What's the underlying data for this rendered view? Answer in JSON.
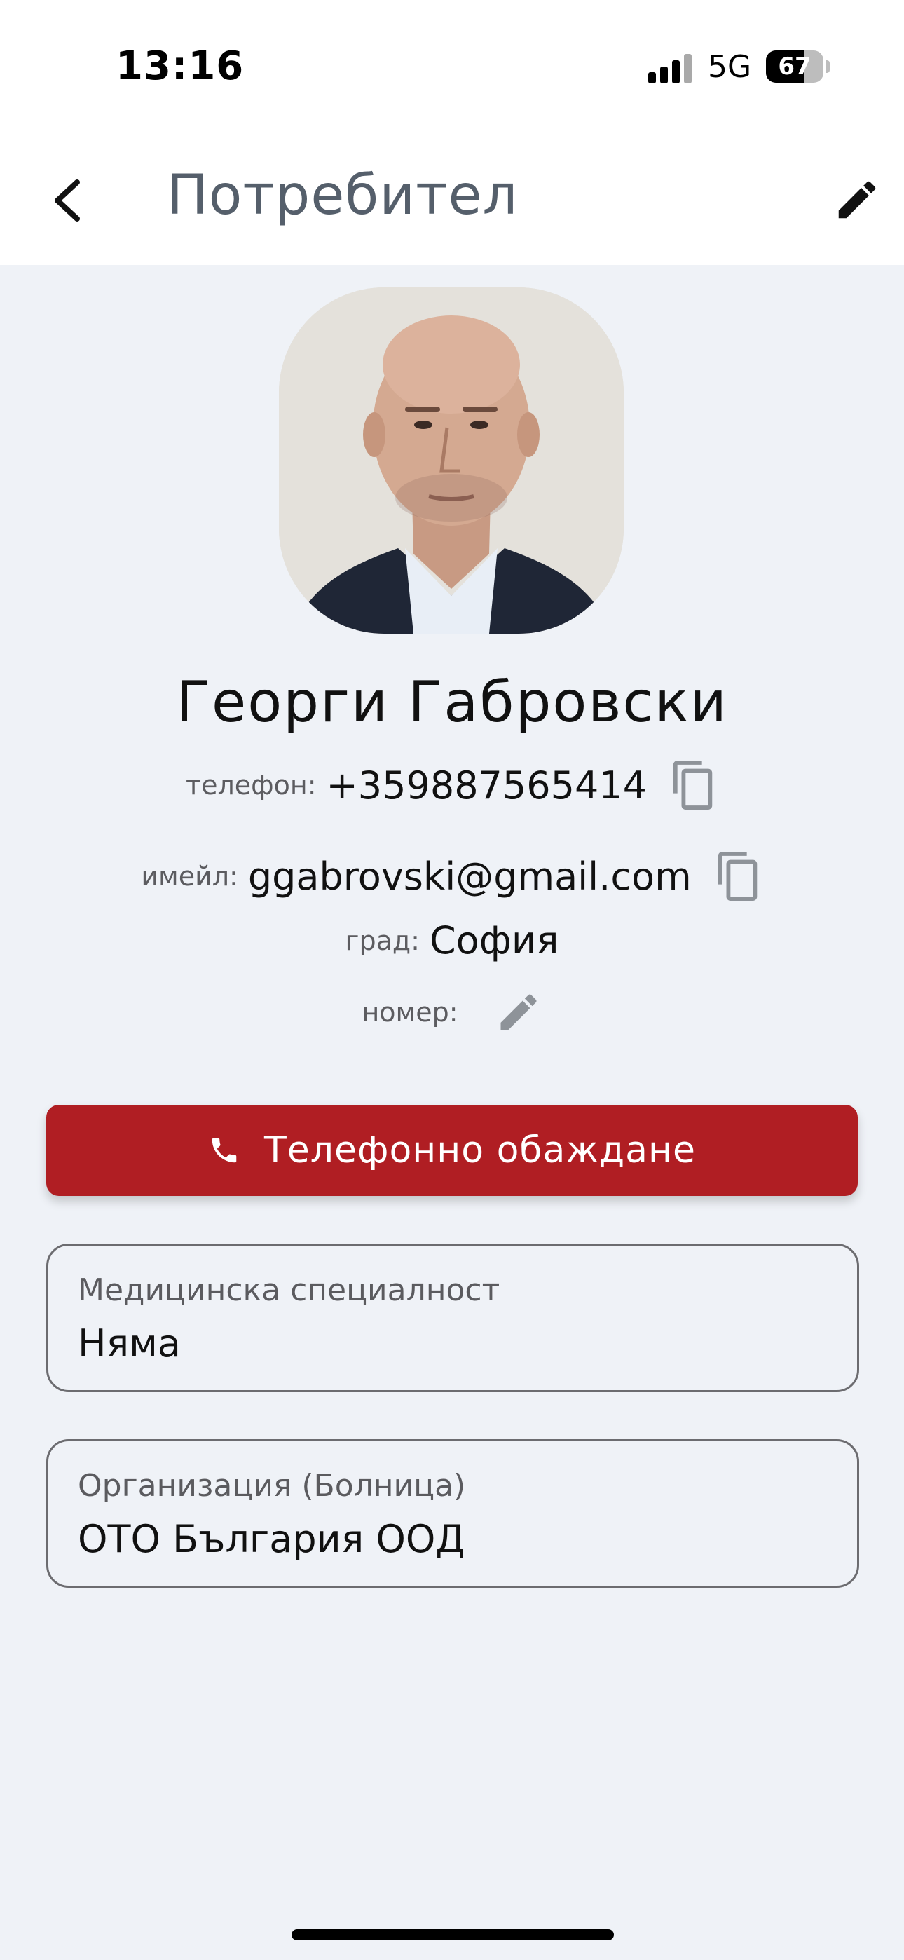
{
  "status_bar": {
    "time": "13:16",
    "network": "5G",
    "battery": "67",
    "battery_level": 0.67
  },
  "header": {
    "title": "Потребител"
  },
  "profile": {
    "name": "Георги Габровски",
    "phone_label": "телефон:",
    "phone": "+359887565414",
    "email_label": "имейл:",
    "email": "ggabrovski@gmail.com",
    "city_label": "град:",
    "city": "София",
    "number_label": "номер:"
  },
  "call_button": {
    "label": "Телефонно обаждане"
  },
  "fields": {
    "specialty": {
      "label": "Медицинска специалност",
      "value": "Няма"
    },
    "organization": {
      "label": "Организация (Болница)",
      "value": "ОТО България ООД"
    }
  },
  "colors": {
    "accent": "#b01e23",
    "background": "#eff2f7",
    "icon_gray": "#8e9399"
  }
}
